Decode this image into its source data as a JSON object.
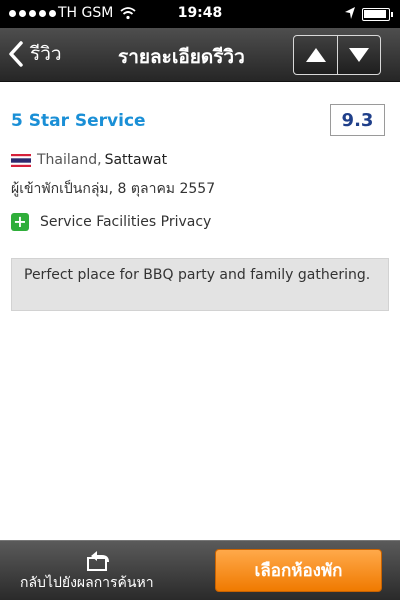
{
  "status_bar": {
    "carrier": "TH GSM",
    "time": "19:48",
    "icons": [
      "signal-dots",
      "wifi-icon",
      "location-arrow-icon",
      "battery-icon"
    ]
  },
  "nav": {
    "back_label": "รีวิว",
    "title": "รายละเอียดรีวิว",
    "icons": [
      "chevron-left-icon",
      "arrow-up-icon",
      "arrow-down-icon"
    ]
  },
  "review": {
    "title": "5 Star Service",
    "score": "9.3",
    "country": "Thailand,",
    "reviewer": "Sattawat",
    "stay_info": "ผู้เข้าพักเป็นกลุ่ม, 8 ตุลาคม 2557",
    "liked": "Service Facilities Privacy",
    "comment": "Perfect place for BBQ party and family gathering."
  },
  "bottom_bar": {
    "back_to_results": "กลับไปยังผลการค้นหา",
    "book_button": "เลือกห้องพัก"
  },
  "colors": {
    "title_blue": "#1a8fd6",
    "score_navy": "#1f3f8a",
    "plus_green": "#2fae3a",
    "book_orange": "#f07a00"
  }
}
